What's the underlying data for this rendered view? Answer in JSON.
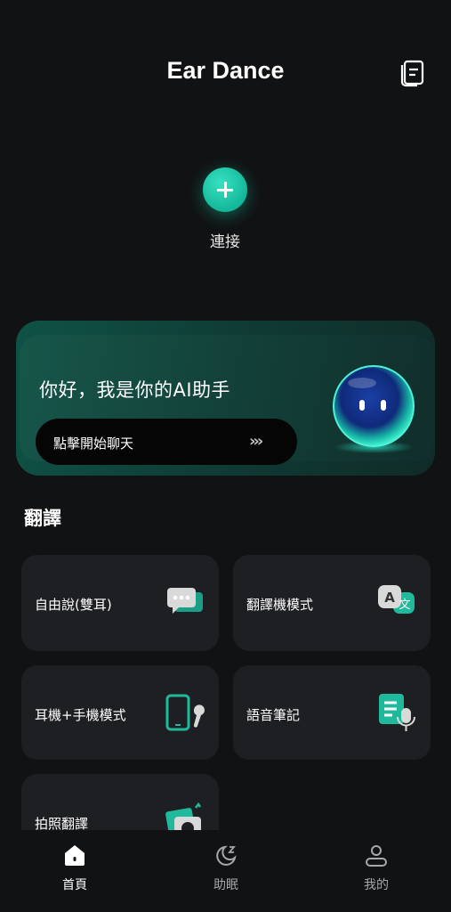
{
  "header": {
    "title": "Ear Dance",
    "notes_icon": "notes-icon"
  },
  "connect": {
    "label": "連接",
    "icon": "plus-icon"
  },
  "ai_card": {
    "greeting": "你好，我是你的AI助手",
    "chat_button": "點擊開始聊天",
    "chevrons": "›››"
  },
  "translate": {
    "section_title": "翻譯",
    "tiles": [
      {
        "label": "自由說(雙耳)",
        "icon": "chat-bubbles-icon"
      },
      {
        "label": "翻譯機模式",
        "icon": "translate-icon"
      },
      {
        "label": "耳機+手機模式",
        "icon": "phone-earbud-icon"
      },
      {
        "label": "語音筆記",
        "icon": "voice-note-icon"
      },
      {
        "label": "拍照翻譯",
        "icon": "camera-icon"
      }
    ]
  },
  "tabbar": {
    "tabs": [
      {
        "label": "首頁",
        "icon": "home-icon",
        "active": true
      },
      {
        "label": "助眠",
        "icon": "sleep-icon",
        "active": false
      },
      {
        "label": "我的",
        "icon": "profile-icon",
        "active": false
      }
    ]
  },
  "colors": {
    "background": "#111214",
    "accent": "#1fc9a8",
    "tile": "#1e1f22",
    "inactive": "#a8a8a8"
  }
}
